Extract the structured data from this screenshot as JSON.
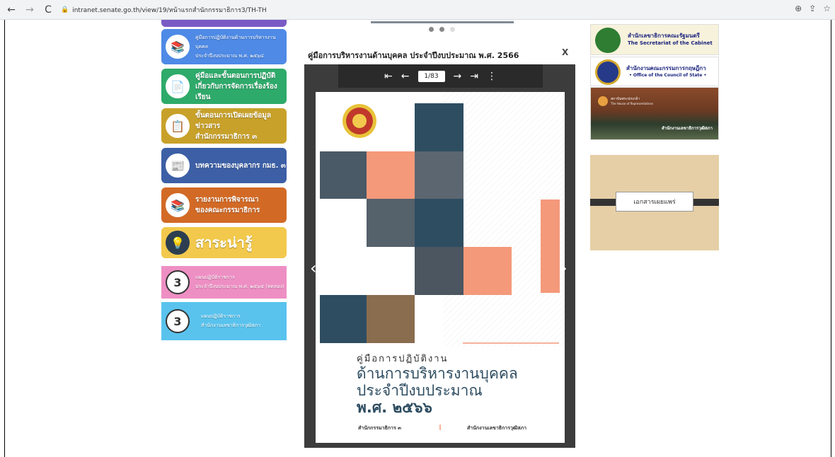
{
  "browser": {
    "url": "intranet.senate.go.th/view/19/หน้าแรกสำนักกรรมาธิการ3/TH-TH"
  },
  "menu": {
    "items": [
      {
        "label_1": "คู่มือการปฏิบัติงานด้านการบริหารงานบุคคล",
        "label_2": "ประจำปีงบประมาณ พ.ศ. ๒๕๖๔",
        "color": "#4e8ae6",
        "icon": "books-icon"
      },
      {
        "label_1": "คู่มือและขั้นตอนการปฏิบัติ",
        "label_2": "เกี่ยวกับการจัดการเรื่องร้องเรียน",
        "color": "#2eaa6a",
        "icon": "document-icon"
      },
      {
        "label_1": "ขั้นตอนการเปิดเผยข้อมูลข่าวสาร",
        "label_2": "สำนักกรรมาธิการ ๓",
        "color": "#c8a12a",
        "icon": "clipboard-icon"
      },
      {
        "label_1": "บทความของบุคลากร กมธ. ๓",
        "label_2": "",
        "color": "#3c5fa6",
        "icon": "article-icon"
      },
      {
        "label_1": "รายงานการพิจารณา",
        "label_2": "ของคณะกรรมาธิการ",
        "color": "#d26a26",
        "icon": "report-books-icon"
      },
      {
        "label_1": "สาระน่ารู้",
        "label_2": "",
        "color": "#f2c94c",
        "icon": "lightbulb-icon"
      },
      {
        "label_1": "แผนปฏิบัติราชการ",
        "label_2": "ประจำปีงบประมาณ พ.ศ. ๒๕๖๕ (ทดลอง)",
        "color": "#ee8fc4",
        "icon": "number-3-icon"
      },
      {
        "label_1": "แผนปฏิบัติราชการ",
        "label_2": "สำนักงานเลขาธิการวุฒิสภา",
        "color": "#59c3ee",
        "icon": "number-3-icon"
      }
    ]
  },
  "viewer": {
    "title": "คู่มือการบริหารงานด้านบุคคล ประจำปีงบประมาณ พ.ศ. 2566",
    "close": "X",
    "page_indicator": "1/83",
    "cover": {
      "subtitle": "คู่มือการปฏิบัติงาน",
      "title_1": "ด้านการบริหารงานบุคคล",
      "title_2": "ประจำปีงบประมาณ",
      "title_3": "พ.ศ. ๒๕๖๖",
      "footer_left": "สำนักกรรมาธิการ ๓",
      "footer_right": "สำนักงานเลขาธิการวุฒิสภา"
    }
  },
  "banners": {
    "cabinet_th": "สำนักเลขาธิการคณะรัฐมนตรี",
    "cabinet_en": "The Secretariat of the Cabinet",
    "council_th": "สำนักงานคณะกรรมการกฤษฎีกา",
    "council_en": "• Office of the Council of State •",
    "parliament_th": "สถาบันพระปกเกล้า",
    "parliament_en": "The House of Representatives",
    "parliament_caption": "สำนักงานเลขาธิการวุฒิสภา",
    "publication": "เอกสารเผยแพร่"
  }
}
